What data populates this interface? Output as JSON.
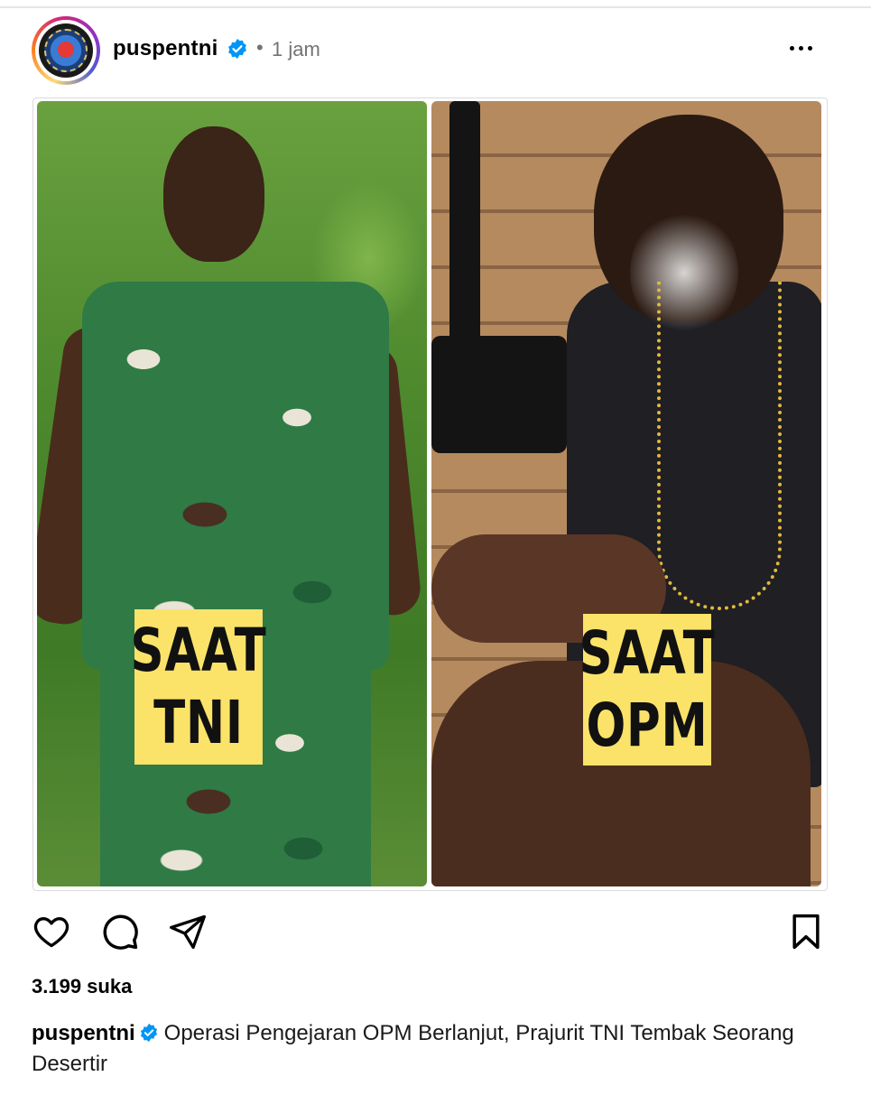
{
  "post": {
    "username": "puspentni",
    "separator": "•",
    "time": "1 jam",
    "verified_color": "#0095f6"
  },
  "media": {
    "left_label": [
      "SAAT",
      "TNI"
    ],
    "right_label": [
      "SAAT",
      "OPM"
    ],
    "label_color": "#fbe36a"
  },
  "actions": {
    "like_icon": "heart-icon",
    "comment_icon": "comment-icon",
    "share_icon": "send-icon",
    "save_icon": "bookmark-icon"
  },
  "likes_text": "3.199 suka",
  "caption": {
    "username": "puspentni",
    "text": "Operasi Pengejaran OPM Berlanjut, Prajurit TNI Tembak Seorang Desertir"
  }
}
